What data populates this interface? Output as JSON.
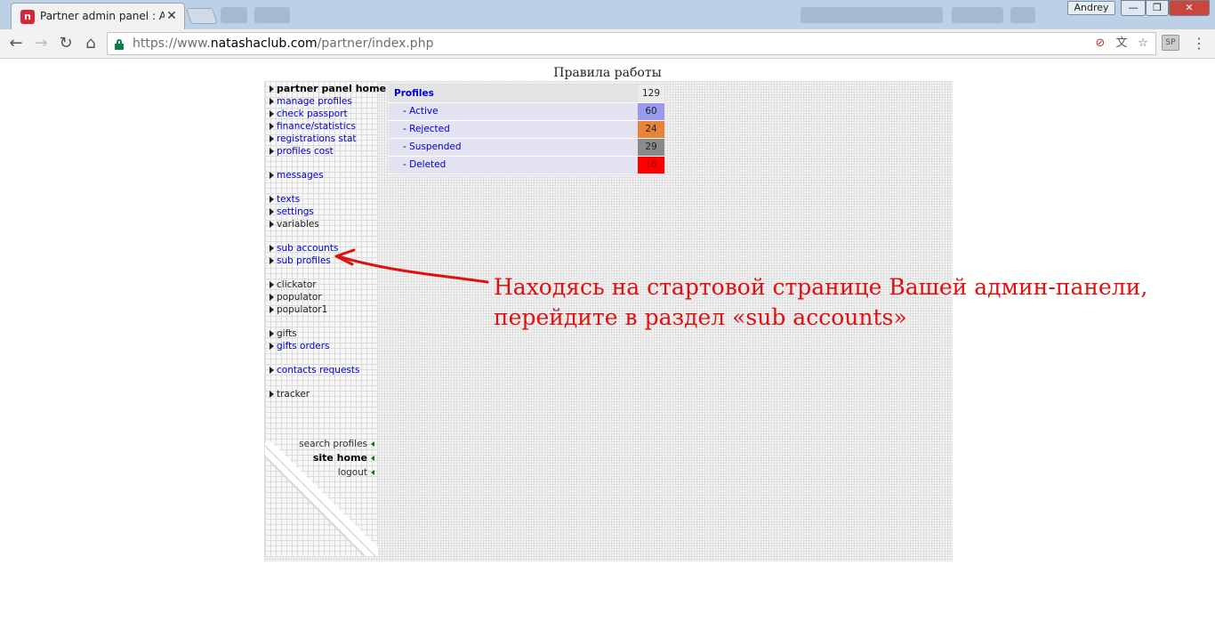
{
  "browser": {
    "tab_title": "Partner admin panel : Affil",
    "tab_favicon": "n",
    "close_glyph": "✕",
    "user_badge": "Andrey",
    "win_minimize": "—",
    "win_maximize": "❐",
    "win_close": "✕",
    "url_scheme": "https://www.",
    "url_host": "natashaclub.com",
    "url_path": "/partner/index.php",
    "ext_label": "SP",
    "menu_glyph": "⋮",
    "nav_back": "←",
    "nav_forward": "→",
    "nav_reload": "↻",
    "nav_home": "⌂",
    "omni_icons": [
      "security-blocked-icon",
      "translate-icon",
      "bookmark-star-icon"
    ],
    "omni_glyphs": [
      "⊘",
      "文",
      "☆"
    ]
  },
  "page": {
    "title": "Правила работы"
  },
  "sidebar": {
    "groups": [
      [
        {
          "label": "partner panel home",
          "style": "bold"
        },
        {
          "label": "manage profiles",
          "style": "link"
        },
        {
          "label": "check passport",
          "style": "link"
        },
        {
          "label": "finance/statistics",
          "style": "link"
        },
        {
          "label": "registrations stat",
          "style": "link"
        },
        {
          "label": "profiles cost",
          "style": "link"
        }
      ],
      [
        {
          "label": "messages",
          "style": "link"
        }
      ],
      [
        {
          "label": "texts",
          "style": "link"
        },
        {
          "label": "settings",
          "style": "link"
        },
        {
          "label": "variables",
          "style": "dark"
        }
      ],
      [
        {
          "label": "sub accounts",
          "style": "link"
        },
        {
          "label": "sub profiles",
          "style": "link"
        }
      ],
      [
        {
          "label": "clickator",
          "style": "dark"
        },
        {
          "label": "populator",
          "style": "dark"
        },
        {
          "label": "populator1",
          "style": "dark"
        }
      ],
      [
        {
          "label": "gifts",
          "style": "dark"
        },
        {
          "label": "gifts orders",
          "style": "link"
        }
      ],
      [
        {
          "label": "contacts requests",
          "style": "link"
        }
      ],
      [
        {
          "label": "tracker",
          "style": "dark"
        }
      ]
    ],
    "bottom_links": [
      {
        "label": "search profiles",
        "style": "normal"
      },
      {
        "label": "site home",
        "style": "bold"
      },
      {
        "label": "logout",
        "style": "normal"
      }
    ]
  },
  "stats": {
    "header": {
      "label": "Profiles",
      "value": "129"
    },
    "rows": [
      {
        "label": "- Active",
        "value": "60",
        "color": "#9999ee",
        "text_color": "#222"
      },
      {
        "label": "- Rejected",
        "value": "24",
        "color": "#e8843a",
        "text_color": "#222"
      },
      {
        "label": "- Suspended",
        "value": "29",
        "color": "#8a8a8a",
        "text_color": "#222"
      },
      {
        "label": "- Deleted",
        "value": "16",
        "color": "#ff0000",
        "text_color": "#aa0000"
      }
    ]
  },
  "annotation": {
    "line1": "Находясь на стартовой странице Вашей админ-панели,",
    "line2": "перейдите в раздел «sub accounts»",
    "color": "#e01010"
  }
}
